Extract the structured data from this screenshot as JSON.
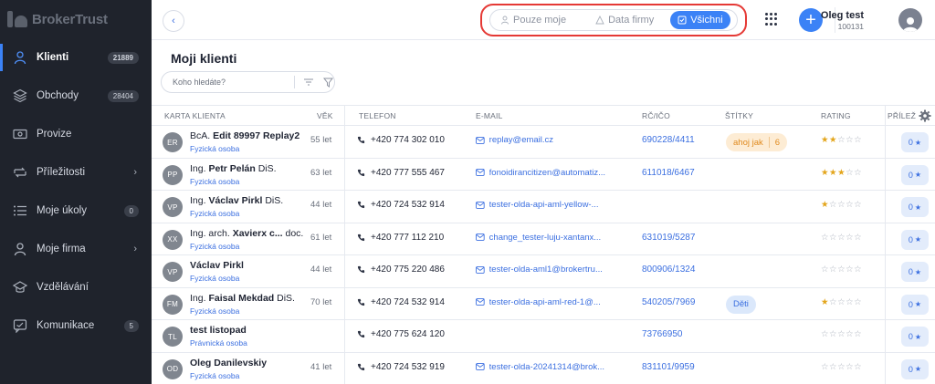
{
  "logo": {
    "text": "BrokerTrust"
  },
  "sidebar": {
    "items": [
      {
        "label": "Klienti",
        "badge": "21889",
        "active": true,
        "icon": "user-icon"
      },
      {
        "label": "Obchody",
        "badge": "28404",
        "icon": "layers-icon"
      },
      {
        "label": "Provize",
        "badge": "",
        "icon": "money-icon"
      },
      {
        "label": "Příležitosti",
        "badge": "",
        "chevron": true,
        "icon": "opportunity-icon"
      },
      {
        "label": "Moje úkoly",
        "badge": "0",
        "icon": "list-icon"
      },
      {
        "label": "Moje firma",
        "badge": "",
        "chevron": true,
        "icon": "person-icon"
      },
      {
        "label": "Vzdělávání",
        "badge": "",
        "icon": "education-icon"
      },
      {
        "label": "Komunikace",
        "badge": "5",
        "icon": "chat-icon"
      }
    ]
  },
  "topbar": {
    "filters": [
      "Pouze moje",
      "Data firmy",
      "Všichni"
    ],
    "selected_filter": "Všichni",
    "user_name": "Oleg test",
    "user_id": "100131"
  },
  "main": {
    "title": "Moji klienti",
    "search_placeholder": "Koho hledáte?"
  },
  "table": {
    "headers": {
      "card": "KARTA KLIENTA",
      "age": "VĚK",
      "phone": "TELEFON",
      "email": "E-MAIL",
      "rc": "RČ/IČO",
      "tags": "ŠTÍTKY",
      "rating": "RATING",
      "opportunities": "PŘÍLEŽ"
    },
    "rows": [
      {
        "initials": "ER",
        "prefix": "BcA. ",
        "name": "Edit 89997 Replay2",
        "suffix": "",
        "type": "Fyzická osoba",
        "age": "55 let",
        "phone": "+420 774 302 010",
        "email": "replay@email.cz",
        "rc": "690228/4411",
        "tag": "ahoj jak",
        "tag_count": "6",
        "tag_color": "orange",
        "rating": 2,
        "opp": "0"
      },
      {
        "initials": "PP",
        "prefix": "Ing. ",
        "name": "Petr Pelán",
        "suffix": " DiS.",
        "type": "Fyzická osoba",
        "age": "63 let",
        "phone": "+420 777 555 467",
        "email": "fonoidirancitizen@automatiz...",
        "rc": "611018/6467",
        "tag": "",
        "tag_count": "",
        "rating": 3,
        "opp": "0"
      },
      {
        "initials": "VP",
        "prefix": "Ing. ",
        "name": "Václav Pirkl",
        "suffix": " DiS.",
        "type": "Fyzická osoba",
        "age": "44 let",
        "phone": "+420 724 532 914",
        "email": "tester-olda-api-aml-yellow-...",
        "rc": "",
        "tag": "",
        "tag_count": "",
        "rating": 1,
        "opp": "0"
      },
      {
        "initials": "XX",
        "prefix": "Ing. arch. ",
        "name": "Xavierx c...",
        "suffix": "  doc.",
        "type": "Fyzická osoba",
        "age": "61 let",
        "phone": "+420 777 112 210",
        "email": "change_tester-luju-xantanx...",
        "rc": "631019/5287",
        "tag": "",
        "tag_count": "",
        "rating": 0,
        "opp": "0"
      },
      {
        "initials": "VP",
        "prefix": "",
        "name": "Václav Pirkl",
        "suffix": "",
        "type": "Fyzická osoba",
        "age": "44 let",
        "phone": "+420 775 220 486",
        "email": "tester-olda-aml1@brokertru...",
        "rc": "800906/1324",
        "tag": "",
        "tag_count": "",
        "rating": 0,
        "opp": "0"
      },
      {
        "initials": "FM",
        "prefix": "Ing. ",
        "name": "Faisal Mekdad",
        "suffix": " DiS.",
        "type": "Fyzická osoba",
        "age": "70 let",
        "phone": "+420 724 532 914",
        "email": "tester-olda-api-aml-red-1@...",
        "rc": "540205/7969",
        "tag": "Děti",
        "tag_count": "",
        "tag_color": "blue",
        "rating": 1,
        "opp": "0"
      },
      {
        "initials": "TL",
        "prefix": "",
        "name": "test listopad",
        "suffix": "",
        "type": "Právnická osoba",
        "age": "",
        "phone": "+420 775 624 120",
        "email": "",
        "rc": "73766950",
        "tag": "",
        "tag_count": "",
        "rating": 0,
        "opp": "0"
      },
      {
        "initials": "OD",
        "prefix": "",
        "name": "Oleg Danilevskiy",
        "suffix": "",
        "type": "Fyzická osoba",
        "age": "41 let",
        "phone": "+420 724 532 919",
        "email": "tester-olda-20241314@brok...",
        "rc": "831101/9959",
        "tag": "",
        "tag_count": "",
        "rating": 0,
        "opp": "0"
      }
    ]
  },
  "colors": {
    "accent": "#3b82f6",
    "sidebar_bg": "#1f232c",
    "highlight": "#e53935",
    "star": "#e3a51b"
  }
}
